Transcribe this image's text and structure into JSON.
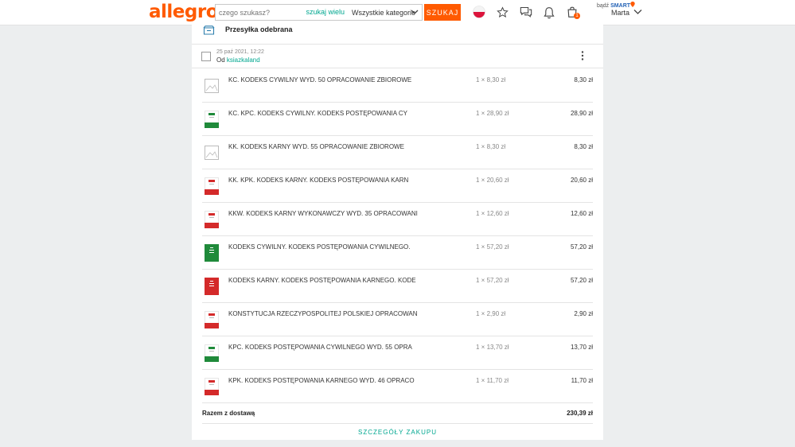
{
  "header": {
    "logo": "allegro",
    "search_placeholder": "czego szukasz?",
    "search_wide": "szukaj wielu",
    "category": "Wszystkie kategorie",
    "search_button": "SZUKAJ",
    "cart_count": "1",
    "smart_prefix": "bądź",
    "smart_brand": "SMART",
    "user_name": "Marta"
  },
  "order": {
    "status": "Przesyłka odebrana",
    "date": "25 paź 2021, 12:22",
    "seller_prefix": "Od",
    "seller": "ksiazkaland",
    "items": [
      {
        "name": "KC. KODEKS CYWILNY WYD. 50 OPRACOWANIE ZBIOROWE",
        "qty": "1 × 8,30 zł",
        "price": "8,30 zł",
        "thumb": "placeholder",
        "color": "#bbbbbb"
      },
      {
        "name": "KC. KPC. KODEKS CYWILNY. KODEKS POSTĘPOWANIA CY",
        "qty": "1 × 28,90 zł",
        "price": "28,90 zł",
        "thumb": "white-green",
        "color": "#1f8a3a"
      },
      {
        "name": "KK. KODEKS KARNY WYD. 55 OPRACOWANIE ZBIOROWE",
        "qty": "1 × 8,30 zł",
        "price": "8,30 zł",
        "thumb": "placeholder",
        "color": "#bbbbbb"
      },
      {
        "name": "KK. KPK. KODEKS KARNY. KODEKS POSTĘPOWANIA KARN",
        "qty": "1 × 20,60 zł",
        "price": "20,60 zł",
        "thumb": "white-red",
        "color": "#d42a2a"
      },
      {
        "name": "KKW. KODEKS KARNY WYKONAWCZY WYD. 35 OPRACOWANI",
        "qty": "1 × 12,60 zł",
        "price": "12,60 zł",
        "thumb": "white-red",
        "color": "#d42a2a"
      },
      {
        "name": "KODEKS CYWILNY. KODEKS POSTĘPOWANIA CYWILNEGO.",
        "qty": "1 × 57,20 zł",
        "price": "57,20 zł",
        "thumb": "solid-green",
        "color": "#1f8a3a"
      },
      {
        "name": "KODEKS KARNY. KODEKS POSTĘPOWANIA KARNEGO. KODE",
        "qty": "1 × 57,20 zł",
        "price": "57,20 zł",
        "thumb": "solid-red",
        "color": "#d42a2a"
      },
      {
        "name": "KONSTYTUCJA RZECZYPOSPOLITEJ POLSKIEJ OPRACOWAN",
        "qty": "1 × 2,90 zł",
        "price": "2,90 zł",
        "thumb": "white-red",
        "color": "#d42a2a"
      },
      {
        "name": "KPC. KODEKS POSTĘPOWANIA CYWILNEGO WYD. 55 OPRA",
        "qty": "1 × 13,70 zł",
        "price": "13,70 zł",
        "thumb": "white-green",
        "color": "#1f8a3a"
      },
      {
        "name": "KPK. KODEKS POSTĘPOWANIA KARNEGO WYD. 46 OPRACO",
        "qty": "1 × 11,70 zł",
        "price": "11,70 zł",
        "thumb": "white-red",
        "color": "#d42a2a"
      }
    ],
    "total_label": "Razem z dostawą",
    "total_value": "230,39 zł",
    "details_link": "SZCZEGÓŁY ZAKUPU"
  }
}
